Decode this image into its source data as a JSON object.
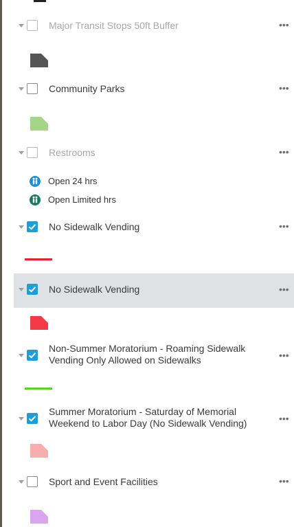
{
  "layers": [
    {
      "label": "Major Transit Stops 50ft Buffer",
      "checked": false,
      "faded": true,
      "more": "•••"
    },
    {
      "label": "Community Parks",
      "checked": false,
      "faded": false,
      "more": "•••"
    },
    {
      "label": "Restrooms",
      "checked": false,
      "faded": true,
      "more": "•••"
    },
    {
      "label": "No Sidewalk Vending",
      "checked": true,
      "faded": false,
      "more": "•••"
    },
    {
      "label": "No Sidewalk Vending",
      "checked": true,
      "faded": false,
      "selected": true,
      "more": "•••"
    },
    {
      "label": "Non-Summer Moratorium - Roaming Sidewalk Vending Only Allowed on Sidewalks",
      "checked": true,
      "faded": false,
      "more": "•••"
    },
    {
      "label": "Summer Moratorium - Saturday of Memorial Weekend to Labor Day (No Sidewalk Vending)",
      "checked": true,
      "faded": false,
      "more": "•••"
    },
    {
      "label": "Sport and Event Facilities",
      "checked": false,
      "faded": false,
      "more": "•••"
    }
  ],
  "legend": {
    "restrooms": [
      {
        "label": "Open 24 hrs",
        "color": "#1f8fd0",
        "icon": "people-icon"
      },
      {
        "label": "Open Limited hrs",
        "color": "#167a63",
        "icon": "people-icon"
      }
    ]
  },
  "swatches": {
    "transit_buffer": "#555555",
    "community_parks": "#a4d68a",
    "no_vending_line": "#e8202a",
    "no_vending_area": "#f43a48",
    "non_summer_line": "#55d421",
    "summer_area": "#f8adad",
    "sport_facilities": "#dba4ee"
  }
}
